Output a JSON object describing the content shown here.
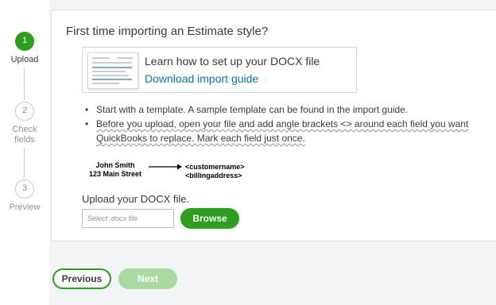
{
  "stepper": {
    "steps": [
      {
        "number": "1",
        "label": "Upload",
        "state": "active"
      },
      {
        "number": "2",
        "label": "Check fields",
        "state": "inactive"
      },
      {
        "number": "3",
        "label": "Preview",
        "state": "inactive"
      }
    ]
  },
  "card": {
    "title": "First time importing an Estimate style?",
    "guide": {
      "title": "Learn how to set up your DOCX file",
      "link": "Download import guide"
    },
    "bullets": [
      "Start with a template. A sample template can be found in the import guide.",
      "Before you upload, open your file and add angle brackets <> around each field you want QuickBooks to replace. Mark each field just once."
    ],
    "example": {
      "left_line1": "John Smith",
      "left_line2": "123 Main Street",
      "right_line1": "<customername>",
      "right_line2": "<billingaddress>"
    },
    "upload": {
      "label": "Upload your DOCX file.",
      "placeholder": "Select .docx file",
      "browse_label": "Browse"
    }
  },
  "footer": {
    "previous_label": "Previous",
    "next_label": "Next"
  },
  "colors": {
    "accent_green": "#2ca01c",
    "disabled_green": "#a9dba0",
    "link_blue": "#0077c5"
  }
}
